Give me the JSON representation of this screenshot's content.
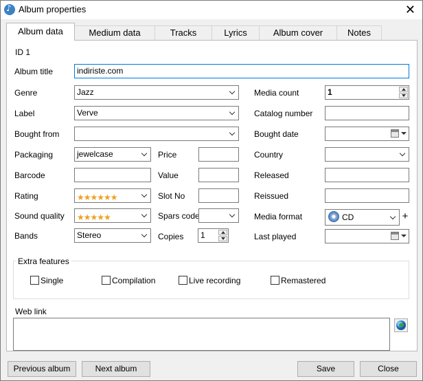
{
  "window": {
    "title": "Album properties",
    "close_glyph": "✕"
  },
  "tabs": [
    {
      "label": "Album data",
      "active": true
    },
    {
      "label": "Medium data"
    },
    {
      "label": "Tracks"
    },
    {
      "label": "Lyrics"
    },
    {
      "label": "Album cover"
    },
    {
      "label": "Notes"
    }
  ],
  "id_label": "ID 1",
  "fields": {
    "album_title": {
      "label": "Album title",
      "value": "indiriste.com"
    },
    "genre": {
      "label": "Genre",
      "value": "Jazz"
    },
    "label": {
      "label": "Label",
      "value": "Verve"
    },
    "bought_from": {
      "label": "Bought from",
      "value": ""
    },
    "packaging": {
      "label": "Packaging",
      "value": "jewelcase"
    },
    "barcode": {
      "label": "Barcode",
      "value": ""
    },
    "rating": {
      "label": "Rating",
      "stars": "★★★★★★",
      "value": 6
    },
    "sound_quality": {
      "label": "Sound quality",
      "stars": "★★★★★",
      "value": 5
    },
    "bands": {
      "label": "Bands",
      "value": "Stereo"
    },
    "price": {
      "label": "Price",
      "value": ""
    },
    "value": {
      "label": "Value",
      "value": ""
    },
    "slot_no": {
      "label": "Slot No",
      "value": ""
    },
    "spars_code": {
      "label": "Spars code",
      "value": ""
    },
    "copies": {
      "label": "Copies",
      "value": "1"
    },
    "media_count": {
      "label": "Media count",
      "value": "1"
    },
    "catalog_number": {
      "label": "Catalog number",
      "value": ""
    },
    "bought_date": {
      "label": "Bought date",
      "value": ""
    },
    "country": {
      "label": "Country",
      "value": ""
    },
    "released": {
      "label": "Released",
      "value": ""
    },
    "reissued": {
      "label": "Reissued",
      "value": ""
    },
    "media_format": {
      "label": "Media format",
      "value": "CD"
    },
    "last_played": {
      "label": "Last played",
      "value": ""
    }
  },
  "extra_features": {
    "title": "Extra features",
    "options": [
      {
        "label": "Single",
        "checked": false
      },
      {
        "label": "Compilation",
        "checked": false
      },
      {
        "label": "Live recording",
        "checked": false
      },
      {
        "label": "Remastered",
        "checked": false
      }
    ]
  },
  "web_link": {
    "label": "Web link",
    "value": ""
  },
  "buttons": {
    "previous": "Previous album",
    "next": "Next album",
    "save": "Save",
    "close": "Close",
    "plus": "+"
  },
  "colors": {
    "focus_border": "#0078d7",
    "star": "#f0a020"
  }
}
